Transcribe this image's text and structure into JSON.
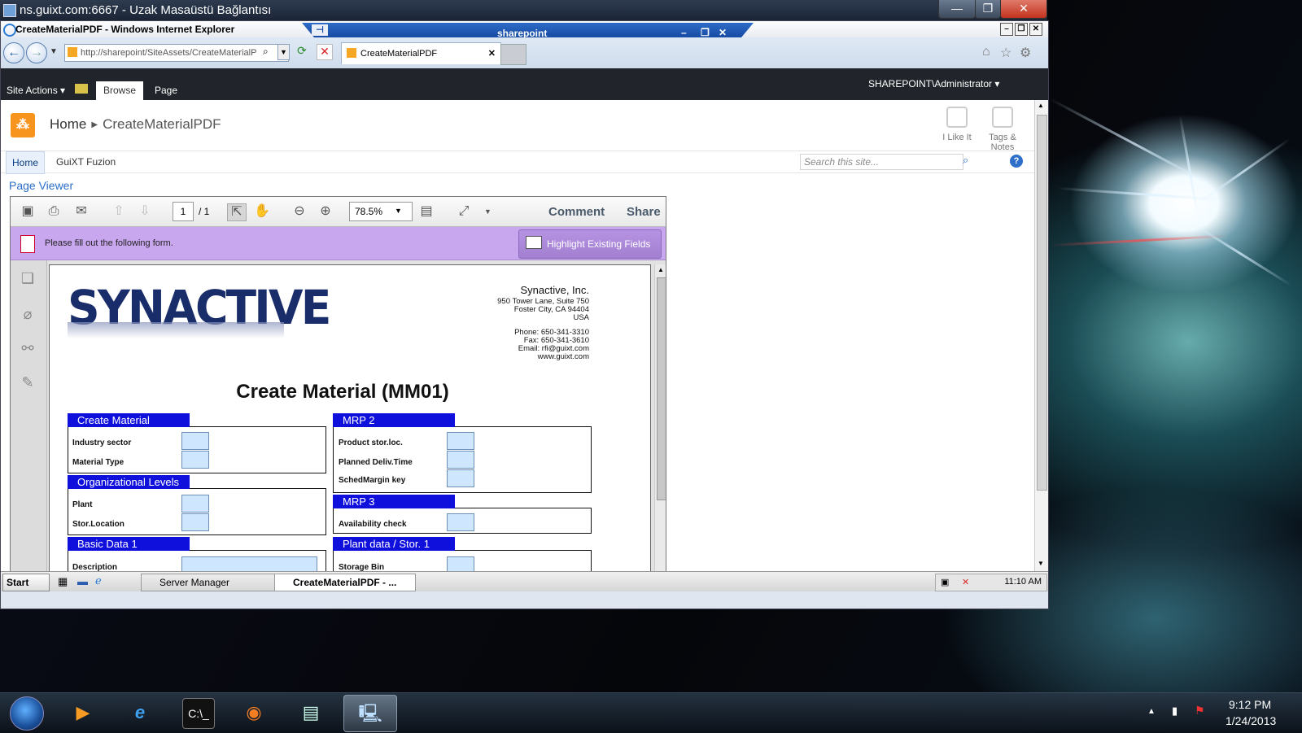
{
  "rdp": {
    "title": "ns.guixt.com:6667 - Uzak Masaüstü Bağlantısı",
    "buttons": [
      "—",
      "❐",
      "✕"
    ]
  },
  "ie": {
    "window_title": "CreateMaterialPDF - Windows Internet Explorer",
    "remote_host": "sharepoint",
    "remote_pin": "⊣",
    "address": "http://sharepoint/SiteAssets/CreateMaterialP",
    "tab_title": "CreateMaterialPDF",
    "tab_close": "✕"
  },
  "sharepoint": {
    "site_actions": "Site Actions ▾",
    "ribbon_tabs": [
      "Browse",
      "Page"
    ],
    "user": "SHAREPOINT\\Administrator ▾",
    "breadcrumb": [
      "Home",
      "CreateMaterialPDF"
    ],
    "i_like_it": "I Like It",
    "tags_notes_1": "Tags &",
    "tags_notes_2": "Notes",
    "topnav": [
      "Home",
      "GuiXT Fuzion"
    ],
    "search_placeholder": "Search this site...",
    "help": "?",
    "web_part_title": "Page Viewer"
  },
  "pdf_viewer": {
    "page_current": "1",
    "page_total": "/ 1",
    "zoom": "78.5%",
    "comment": "Comment",
    "share": "Share",
    "form_message": "Please fill out the following form.",
    "highlight_button": "Highlight Existing Fields"
  },
  "document": {
    "logo_text": "SYNACTIVE",
    "company_name": "Synactive, Inc.",
    "address_lines": [
      "950 Tower Lane, Suite 750",
      "Foster City, CA 94404",
      "USA"
    ],
    "contact_lines": [
      "Phone: 650-341-3310",
      "Fax: 650-341-3610",
      "Email: rfi@guixt.com",
      "www.guixt.com"
    ],
    "title": "Create Material (MM01)",
    "sections": {
      "create_material": {
        "heading": "Create Material",
        "fields": [
          "Industry sector",
          "Material Type"
        ]
      },
      "org_levels": {
        "heading": "Organizational Levels",
        "fields": [
          "Plant",
          "Stor.Location"
        ]
      },
      "basic_data": {
        "heading": "Basic Data 1",
        "fields": [
          "Description"
        ]
      },
      "mrp2": {
        "heading": "MRP 2",
        "fields": [
          "Product stor.loc.",
          "Planned Deliv.Time",
          "SchedMargin key"
        ]
      },
      "mrp3": {
        "heading": "MRP 3",
        "fields": [
          "Availability check"
        ]
      },
      "plant_data": {
        "heading": "Plant data / Stor. 1",
        "fields": [
          "Storage Bin"
        ]
      }
    }
  },
  "remote_taskbar": {
    "start": "Start",
    "buttons": [
      "Server Manager",
      "CreateMaterialPDF - ..."
    ],
    "clock": "11:10 AM"
  },
  "taskbar": {
    "time": "9:12 PM",
    "date": "1/24/2013"
  }
}
